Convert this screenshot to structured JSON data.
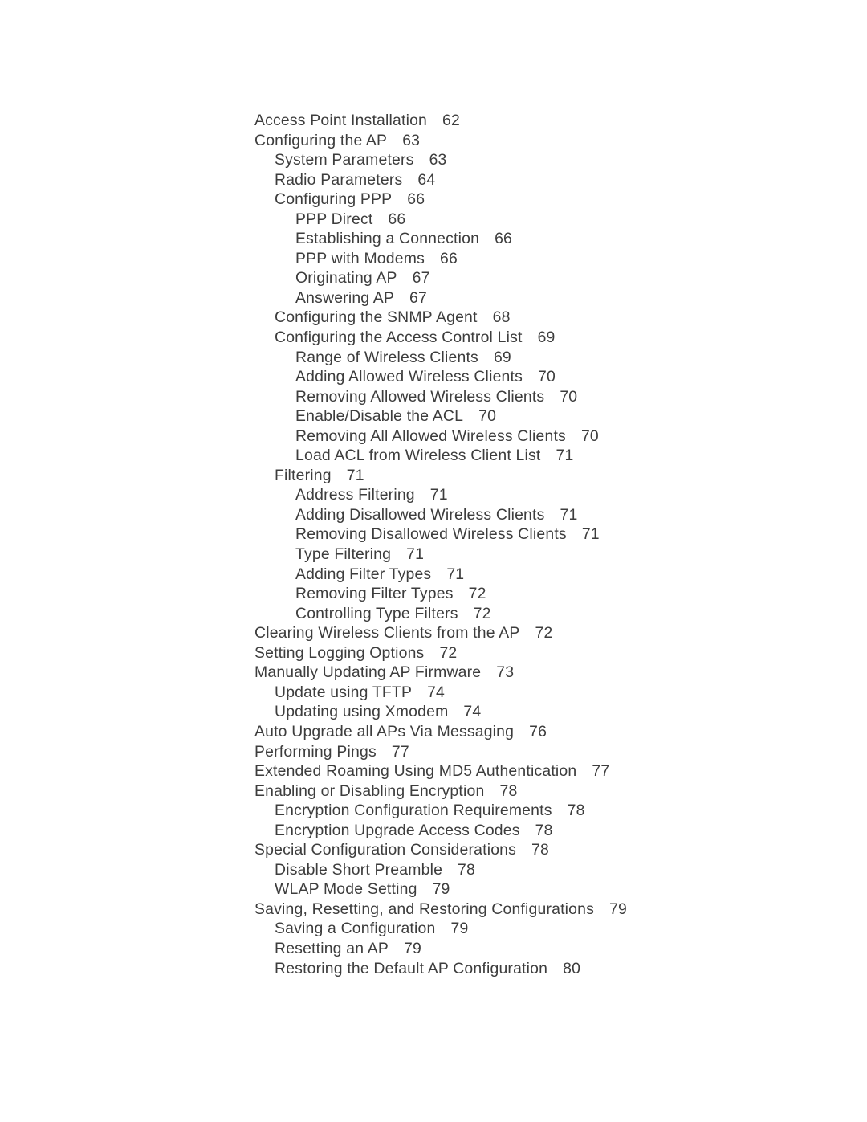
{
  "document": {
    "type": "table-of-contents",
    "text_color": "#3d3d3d",
    "background_color": "#ffffff"
  },
  "toc": {
    "entries": [
      {
        "title": "Access Point Installation",
        "page": "62",
        "level": 1
      },
      {
        "title": "Configuring the AP",
        "page": "63",
        "level": 1
      },
      {
        "title": "System Parameters",
        "page": "63",
        "level": 2
      },
      {
        "title": "Radio Parameters",
        "page": "64",
        "level": 2
      },
      {
        "title": "Configuring PPP",
        "page": "66",
        "level": 2
      },
      {
        "title": "PPP Direct",
        "page": "66",
        "level": 3
      },
      {
        "title": "Establishing a Connection",
        "page": "66",
        "level": 3
      },
      {
        "title": "PPP with Modems",
        "page": "66",
        "level": 3
      },
      {
        "title": "Originating AP",
        "page": "67",
        "level": 3
      },
      {
        "title": "Answering AP",
        "page": "67",
        "level": 3
      },
      {
        "title": "Configuring the SNMP Agent",
        "page": "68",
        "level": 2
      },
      {
        "title": "Configuring the Access Control List",
        "page": "69",
        "level": 2
      },
      {
        "title": "Range of Wireless Clients",
        "page": "69",
        "level": 3
      },
      {
        "title": "Adding Allowed Wireless Clients",
        "page": "70",
        "level": 3
      },
      {
        "title": "Removing Allowed Wireless Clients",
        "page": "70",
        "level": 3
      },
      {
        "title": "Enable/Disable the ACL",
        "page": "70",
        "level": 3
      },
      {
        "title": "Removing All Allowed Wireless Clients",
        "page": "70",
        "level": 3
      },
      {
        "title": "Load ACL from Wireless Client List",
        "page": "71",
        "level": 3
      },
      {
        "title": "Filtering",
        "page": "71",
        "level": 2
      },
      {
        "title": "Address Filtering",
        "page": "71",
        "level": 3
      },
      {
        "title": "Adding Disallowed Wireless Clients",
        "page": "71",
        "level": 3
      },
      {
        "title": "Removing Disallowed Wireless Clients",
        "page": "71",
        "level": 3
      },
      {
        "title": "Type Filtering",
        "page": "71",
        "level": 3
      },
      {
        "title": "Adding Filter Types",
        "page": "71",
        "level": 3
      },
      {
        "title": "Removing Filter Types",
        "page": "72",
        "level": 3
      },
      {
        "title": "Controlling Type Filters",
        "page": "72",
        "level": 3
      },
      {
        "title": "Clearing Wireless Clients from the AP",
        "page": "72",
        "level": 1
      },
      {
        "title": "Setting Logging Options",
        "page": "72",
        "level": 1
      },
      {
        "title": "Manually Updating AP Firmware",
        "page": "73",
        "level": 1
      },
      {
        "title": "Update using TFTP",
        "page": "74",
        "level": 2
      },
      {
        "title": "Updating using Xmodem",
        "page": "74",
        "level": 2
      },
      {
        "title": "Auto Upgrade all APs Via Messaging",
        "page": "76",
        "level": 1
      },
      {
        "title": "Performing Pings",
        "page": "77",
        "level": 1
      },
      {
        "title": "Extended Roaming Using MD5 Authentication",
        "page": "77",
        "level": 1
      },
      {
        "title": "Enabling or Disabling Encryption",
        "page": "78",
        "level": 1
      },
      {
        "title": "Encryption Configuration Requirements",
        "page": "78",
        "level": 2
      },
      {
        "title": "Encryption Upgrade Access Codes",
        "page": "78",
        "level": 2
      },
      {
        "title": "Special Configuration Considerations",
        "page": "78",
        "level": 1
      },
      {
        "title": "Disable Short Preamble",
        "page": "78",
        "level": 2
      },
      {
        "title": "WLAP Mode Setting",
        "page": "79",
        "level": 2
      },
      {
        "title": "Saving, Resetting, and Restoring Configurations",
        "page": "79",
        "level": 1
      },
      {
        "title": "Saving a Configuration",
        "page": "79",
        "level": 2
      },
      {
        "title": "Resetting an AP",
        "page": "79",
        "level": 2
      },
      {
        "title": "Restoring the Default AP Configuration",
        "page": "80",
        "level": 2
      }
    ]
  }
}
